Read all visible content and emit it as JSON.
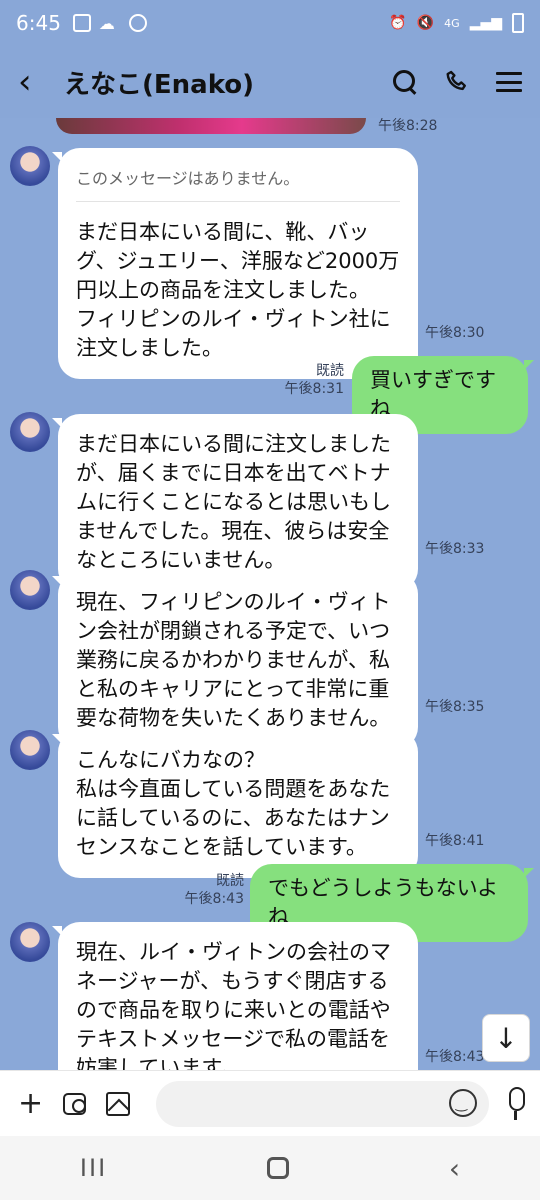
{
  "status_bar": {
    "time": "6:45",
    "network": "4G"
  },
  "header": {
    "back_icon": "chevron-left-icon",
    "title": "えなこ(Enako)",
    "actions": [
      "search-icon",
      "phone-icon",
      "menu-icon"
    ]
  },
  "messages": [
    {
      "side": "in",
      "time": "午後8:28"
    },
    {
      "side": "in",
      "deleted_notice": "このメッセージはありません。",
      "lines": [
        "まだ日本にいる間に、靴、バッ",
        "グ、ジュエリー、洋服など2000万",
        "円以上の商品を注文しました。",
        "フィリピンのルイ・ヴィトン社に",
        "注文しました。"
      ],
      "time": "午後8:30"
    },
    {
      "side": "out",
      "read": "既読",
      "time": "午後8:31",
      "text": "買いすぎですね"
    },
    {
      "side": "in",
      "lines": [
        "まだ日本にいる間に注文しました",
        "が、届くまでに日本を出てベトナ",
        "ムに行くことになるとは思いもし",
        "ませんでした。現在、彼らは安全",
        "なところにいません。"
      ],
      "time": "午後8:33"
    },
    {
      "side": "in",
      "lines": [
        "現在、フィリピンのルイ・ヴィト",
        "ン会社が閉鎖される予定で、いつ",
        "業務に戻るかわかりませんが、私",
        "と私のキャリアにとって非常に重",
        "要な荷物を失いたくありません。"
      ],
      "time": "午後8:35"
    },
    {
      "side": "in",
      "lines": [
        "こんなにバカなの？",
        "私は今直面している問題をあなた",
        "に話しているのに、あなたはナン",
        "センスなことを話しています。"
      ],
      "time": "午後8:41"
    },
    {
      "side": "out",
      "read": "既読",
      "time": "午後8:43",
      "text": "でもどうしようもないよね"
    },
    {
      "side": "in",
      "lines": [
        "現在、ルイ・ヴィトンの会社のマ",
        "ネージャーが、もうすぐ閉店する",
        "ので商品を取りに来いとの電話や",
        "テキストメッセージで私の電話を",
        "妨害しています。"
      ],
      "time": "午後8:43"
    }
  ],
  "scroll_button": "↓",
  "input_bar": {
    "add_label": "+",
    "value": ""
  },
  "nav": {
    "recent_label": "III",
    "back_label": "‹"
  }
}
